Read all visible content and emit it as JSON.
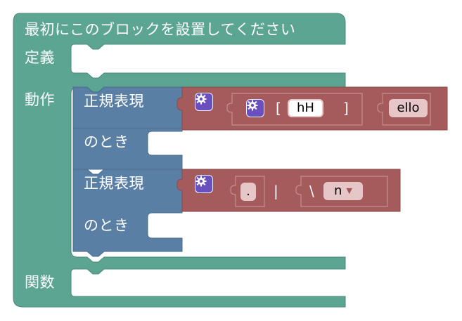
{
  "main_block": {
    "title": "最初にこのブロックを設置してください",
    "definition_label": "定義",
    "action_label": "動作",
    "function_label": "関数"
  },
  "regex_blocks": [
    {
      "label": "正規表現",
      "when_label": "のとき"
    },
    {
      "label": "正規表現",
      "when_label": "のとき"
    }
  ],
  "row1": {
    "open_bracket": "[",
    "text_value": "hH",
    "close_bracket": "]",
    "string_value": "ello"
  },
  "row2": {
    "dot_value": ".",
    "pipe": "|",
    "backslash": "\\",
    "dropdown_value": "n"
  },
  "icons": {
    "mutator": "gear-icon",
    "dropdown": "triangle-down-icon"
  },
  "colors": {
    "main_block": "#5ba592",
    "regex_block": "#5a7fa5",
    "red_block": "#a55b5b",
    "gear": "#6a4fbf",
    "field_pink": "#e7c6c7"
  }
}
